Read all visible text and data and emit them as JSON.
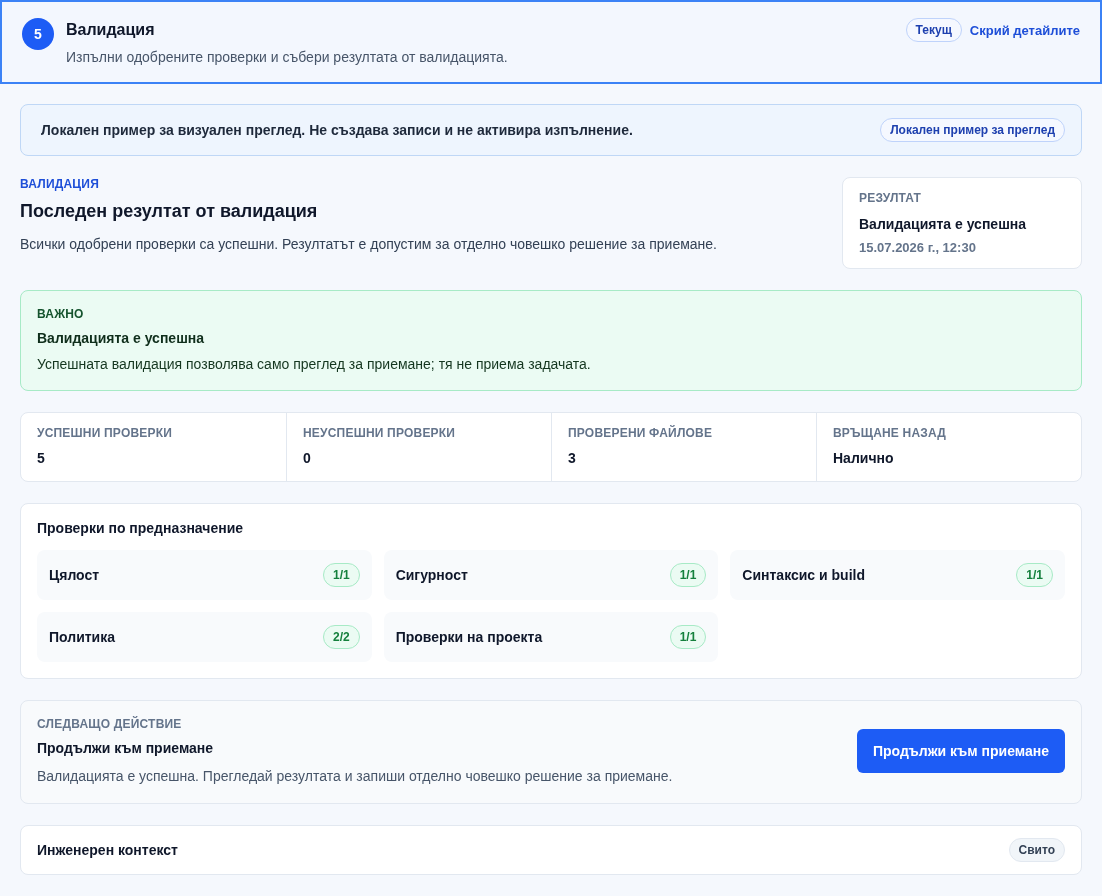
{
  "step": {
    "number": "5",
    "title": "Валидация",
    "subtitle": "Изпълни одобрените проверки и събери резултата от валидацията.",
    "badge": "Текущ",
    "toggle": "Скрий детайлите"
  },
  "notice": {
    "text": "Локален пример за визуален преглед. Не създава записи и не активира изпълнение.",
    "badge": "Локален пример за преглед"
  },
  "summary": {
    "eyebrow": "ВАЛИДАЦИЯ",
    "title": "Последен резултат от валидация",
    "description": "Всички одобрени проверки са успешни. Резултатът е допустим за отделно човешко решение за приемане.",
    "result": {
      "label": "РЕЗУЛТАТ",
      "value": "Валидацията е успешна",
      "time": "15.07.2026 г., 12:30"
    }
  },
  "alert": {
    "label": "ВАЖНО",
    "title": "Валидацията е успешна",
    "text": "Успешната валидация позволява само преглед за приемане; тя не приема задачата."
  },
  "stats": [
    {
      "label": "УСПЕШНИ ПРОВЕРКИ",
      "value": "5"
    },
    {
      "label": "НЕУСПЕШНИ ПРОВЕРКИ",
      "value": "0"
    },
    {
      "label": "ПРОВЕРЕНИ ФАЙЛОВЕ",
      "value": "3"
    },
    {
      "label": "ВРЪЩАНЕ НАЗАД",
      "value": "Налично"
    }
  ],
  "checks": {
    "title": "Проверки по предназначение",
    "items": [
      {
        "name": "Цялост",
        "count": "1/1"
      },
      {
        "name": "Сигурност",
        "count": "1/1"
      },
      {
        "name": "Синтаксис и build",
        "count": "1/1"
      },
      {
        "name": "Политика",
        "count": "2/2"
      },
      {
        "name": "Проверки на проекта",
        "count": "1/1"
      }
    ]
  },
  "next_action": {
    "eyebrow": "СЛЕДВАЩО ДЕЙСТВИЕ",
    "title": "Продължи към приемане",
    "text": "Валидацията е успешна. Прегледай резултата и запиши отделно човешко решение за приемане.",
    "button": "Продължи към приемане"
  },
  "context": {
    "title": "Инженерен контекст",
    "badge": "Свито"
  }
}
